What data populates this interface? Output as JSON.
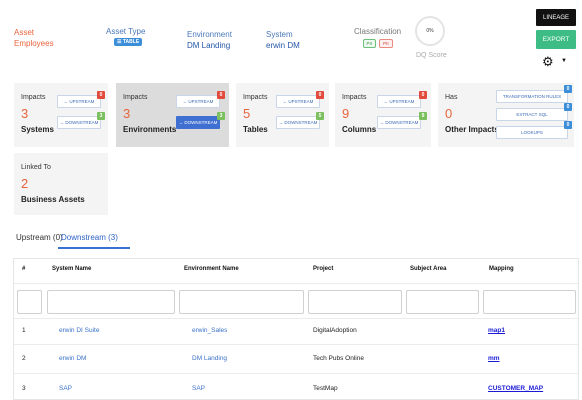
{
  "header": {
    "asset_label": "Asset",
    "asset_value": "Employees",
    "asset_type_label": "Asset Type",
    "asset_type_value": "TABLE",
    "environment_label": "Environment",
    "environment_value": "DM Landing",
    "system_label": "System",
    "system_value": "erwin DM",
    "classification_label": "Classification",
    "classification_badges": [
      "PII",
      "PII"
    ],
    "dq_percent": "0%",
    "dq_label": "DQ Score",
    "lineage_label": "LINEAGE",
    "export_label": "EXPORT",
    "icons": {
      "settings": "gear-icon",
      "settings_caret": "caret-down-icon"
    }
  },
  "impacts": [
    {
      "label": "Impacts",
      "count": "3",
      "type": "Systems",
      "upstream_label": "UPSTREAM",
      "downstream_label": "DOWNSTREAM",
      "upstream_badge": "0",
      "downstream_badge": "3"
    },
    {
      "label": "Impacts",
      "count": "3",
      "type": "Environments",
      "upstream_label": "UPSTREAM",
      "downstream_label": "DOWNSTREAM",
      "upstream_badge": "0",
      "downstream_badge": "3"
    },
    {
      "label": "Impacts",
      "count": "5",
      "type": "Tables",
      "upstream_label": "UPSTREAM",
      "downstream_label": "DOWNSTREAM",
      "upstream_badge": "0",
      "downstream_badge": "5"
    },
    {
      "label": "Impacts",
      "count": "9",
      "type": "Columns",
      "upstream_label": "UPSTREAM",
      "downstream_label": "DOWNSTREAM",
      "upstream_badge": "0",
      "downstream_badge": "9"
    }
  ],
  "other_impacts": {
    "label": "Has",
    "count": "0",
    "type": "Other Impacts",
    "buttons": [
      {
        "label": "TRANSFORMATION RULES",
        "badge": "0"
      },
      {
        "label": "EXTRACT SQL",
        "badge": "0"
      },
      {
        "label": "LOOKUPS",
        "badge": "0"
      }
    ]
  },
  "linked": {
    "label": "Linked To",
    "count": "2",
    "type": "Business Assets"
  },
  "tabs": {
    "upstream": "Upstream (0)",
    "downstream": "Downstream (3)"
  },
  "table": {
    "columns": [
      "#",
      "System Name",
      "Environment Name",
      "Project",
      "Subject Area",
      "Mapping"
    ],
    "rows": [
      {
        "num": "1",
        "system": "erwin DI Suite",
        "environment": "erwin_Sales",
        "project": "DigitalAdoption",
        "subject_area": "",
        "mapping": "map1"
      },
      {
        "num": "2",
        "system": "erwin DM",
        "environment": "DM Landing",
        "project": "Tech Pubs Online",
        "subject_area": "",
        "mapping": "mm"
      },
      {
        "num": "3",
        "system": "SAP",
        "environment": "SAP",
        "project": "TestMap",
        "subject_area": "",
        "mapping": "CUSTOMER_MAP"
      }
    ]
  },
  "colors": {
    "accent_orange": "#e8643c",
    "export_green": "#3dbd85",
    "link_blue": "#3a72c8",
    "active_blue": "#3f6fd1"
  }
}
